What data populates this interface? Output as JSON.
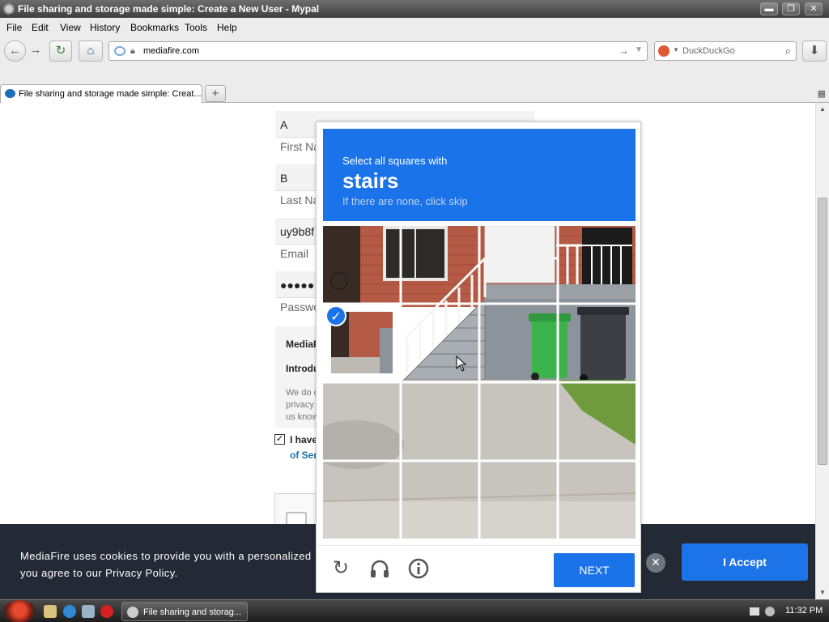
{
  "window": {
    "title": "File sharing and storage made simple: Create a New User - Mypal",
    "controls": {
      "minimize": "▬",
      "maximize": "❐",
      "close": "✕"
    }
  },
  "menu": [
    "File",
    "Edit",
    "View",
    "History",
    "Bookmarks",
    "Tools",
    "Help"
  ],
  "nav": {
    "url": "mediafire.com",
    "search_placeholder": "DuckDuckGo"
  },
  "tabs": [
    {
      "label": "File sharing and storage made simple: Creat..."
    }
  ],
  "page": {
    "fields": [
      {
        "value": "A",
        "label": "First Na"
      },
      {
        "value": "B",
        "label": "Last Na"
      },
      {
        "value": "uy9b8f",
        "label": "Email"
      },
      {
        "value": "●●●●●",
        "label": "Passwo"
      }
    ],
    "info": {
      "heading1": "MediaF",
      "heading2": "Introdu",
      "para": [
        "We do c",
        "privacy",
        "us know"
      ]
    },
    "agree_text": "I have",
    "terms_text": "of Ser"
  },
  "cookie": {
    "line1": "MediaFire uses cookies to provide you with a personalized",
    "line2": "you agree to our Privacy Policy.",
    "accept_label": "I Accept",
    "close_label": "✕"
  },
  "captcha": {
    "instruction": "Select all squares with",
    "target": "stairs",
    "hint": "If there are none, click skip",
    "next_label": "NEXT",
    "selected_tiles": [
      4
    ]
  },
  "taskbar": {
    "task_label": "File sharing and storag...",
    "clock": "11:32 PM"
  },
  "colors": {
    "captcha_blue": "#1a73e8",
    "cookie_bg": "#232a35",
    "link_blue": "#1d6fa8"
  }
}
